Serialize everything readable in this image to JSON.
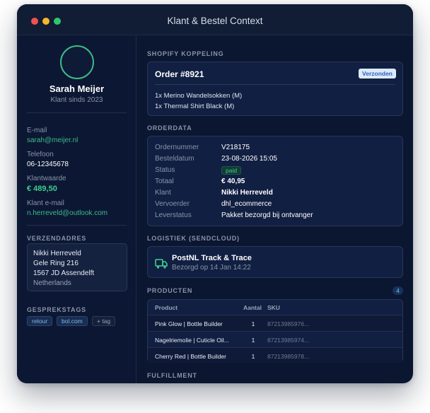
{
  "window": {
    "title": "Klant & Bestel Context"
  },
  "customer": {
    "name": "Sarah Meijer",
    "since": "Klant sinds 2023",
    "email_label": "E-mail",
    "email": "sarah@meijer.nl",
    "phone_label": "Telefoon",
    "phone": "06-12345678",
    "value_label": "Klantwaarde",
    "value": "€ 489,50",
    "cust_email_label": "Klant e-mail",
    "cust_email": "n.herreveld@outlook.com"
  },
  "shipping": {
    "heading": "VERZENDADRES",
    "lines": [
      "Nikki Herreveld",
      "Gele Ring 216",
      "1567 JD Assendelft",
      "Netherlands"
    ]
  },
  "tags": {
    "heading": "GESPREKSTAGS",
    "items": [
      "retour",
      "bol.com"
    ],
    "add_label": "+ tag"
  },
  "shopify": {
    "heading": "SHOPIFY KOPPELING",
    "order_title": "Order #8921",
    "status_badge": "Verzonden",
    "items": [
      "1x Merino Wandelsokken (M)",
      "1x Thermal Shirt Black (M)"
    ]
  },
  "orderdata": {
    "heading": "ORDERDATA",
    "rows": [
      {
        "key": "Ordernummer",
        "value": "V218175"
      },
      {
        "key": "Besteldatum",
        "value": "23-08-2026 15:05"
      },
      {
        "key": "Status",
        "value": "paid"
      },
      {
        "key": "Totaal",
        "value": "€ 40,95"
      },
      {
        "key": "Klant",
        "value": "Nikki Herreveld"
      },
      {
        "key": "Vervoerder",
        "value": "dhl_ecommerce"
      },
      {
        "key": "Leverstatus",
        "value": "Pakket bezorgd bij ontvanger"
      }
    ]
  },
  "logistics": {
    "heading": "LOGISTIEK (SENDCLOUD)",
    "title": "PostNL Track & Trace",
    "subtitle": "Bezorgd op 14 Jan 14:22"
  },
  "products": {
    "heading": "PRODUCTEN",
    "count": "4",
    "columns": [
      "Product",
      "Aantal",
      "SKU"
    ],
    "rows": [
      {
        "product": "Pink Glow | Bottle Builder",
        "qty": "1",
        "sku": "87213985976..."
      },
      {
        "product": "Nagelriemolie | Cuticle Oil...",
        "qty": "1",
        "sku": "87213985974..."
      },
      {
        "product": "Cherry Red | Bottle Builder",
        "qty": "1",
        "sku": "87213985978..."
      }
    ]
  },
  "fulfillment": {
    "heading": "FULFILLMENT"
  },
  "colors": {
    "accent_green": "#3dbb8a",
    "badge_blue": "#dce9fb",
    "window_bg": "#0b1631"
  }
}
